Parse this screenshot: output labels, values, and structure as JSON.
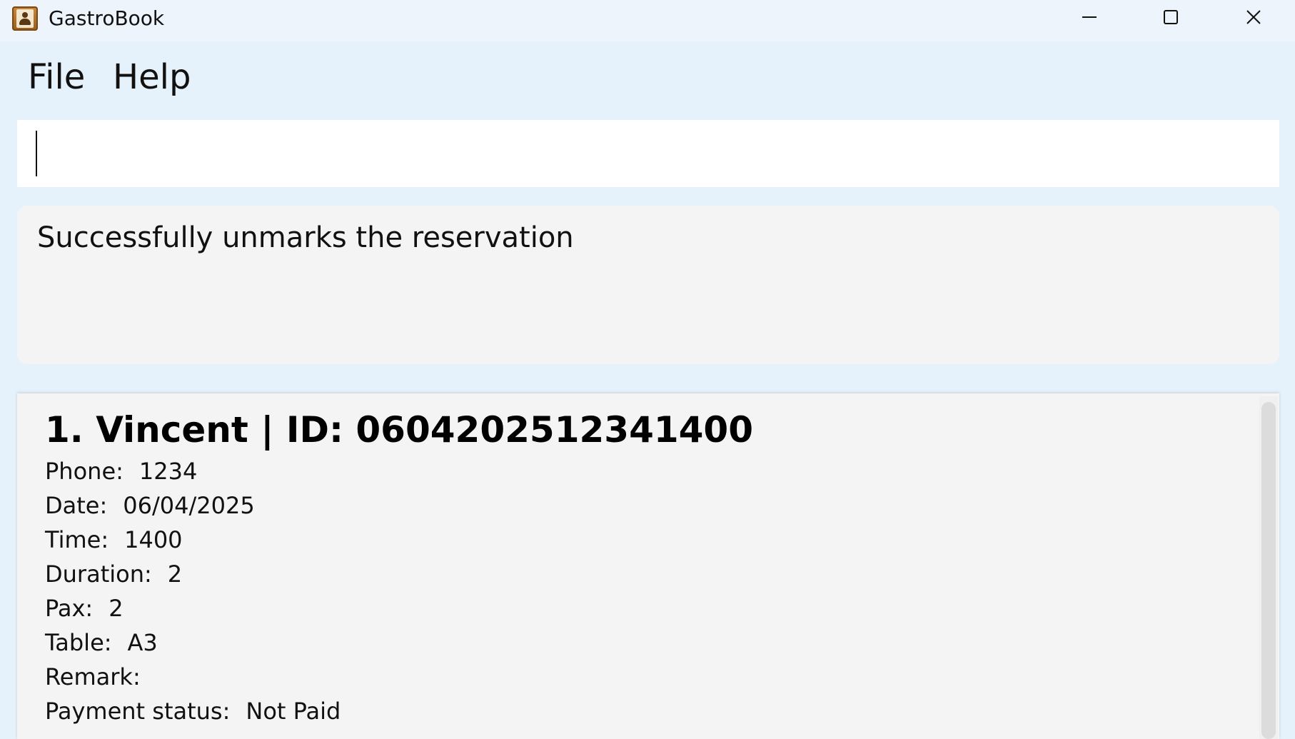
{
  "window": {
    "title": "GastroBook",
    "icon": "address-book-icon"
  },
  "menu": {
    "items": [
      {
        "label": "File"
      },
      {
        "label": "Help"
      }
    ]
  },
  "command": {
    "value": ""
  },
  "result": {
    "message": "Successfully unmarks the reservation"
  },
  "reservations": [
    {
      "title": "1. Vincent | ID: 0604202512341400",
      "phone_label": "Phone:",
      "phone": "1234",
      "date_label": "Date:",
      "date": "06/04/2025",
      "time_label": "Time:",
      "time": "1400",
      "duration_label": "Duration:",
      "duration": "2",
      "pax_label": "Pax:",
      "pax": "2",
      "table_label": "Table:",
      "table": "A3",
      "remark_label": "Remark:",
      "remark": "",
      "payment_label": "Payment status:",
      "payment": "Not Paid"
    }
  ],
  "colors": {
    "background": "#e6f2fb",
    "titlebar": "#eef4fb",
    "panel": "#f4f4f4"
  }
}
